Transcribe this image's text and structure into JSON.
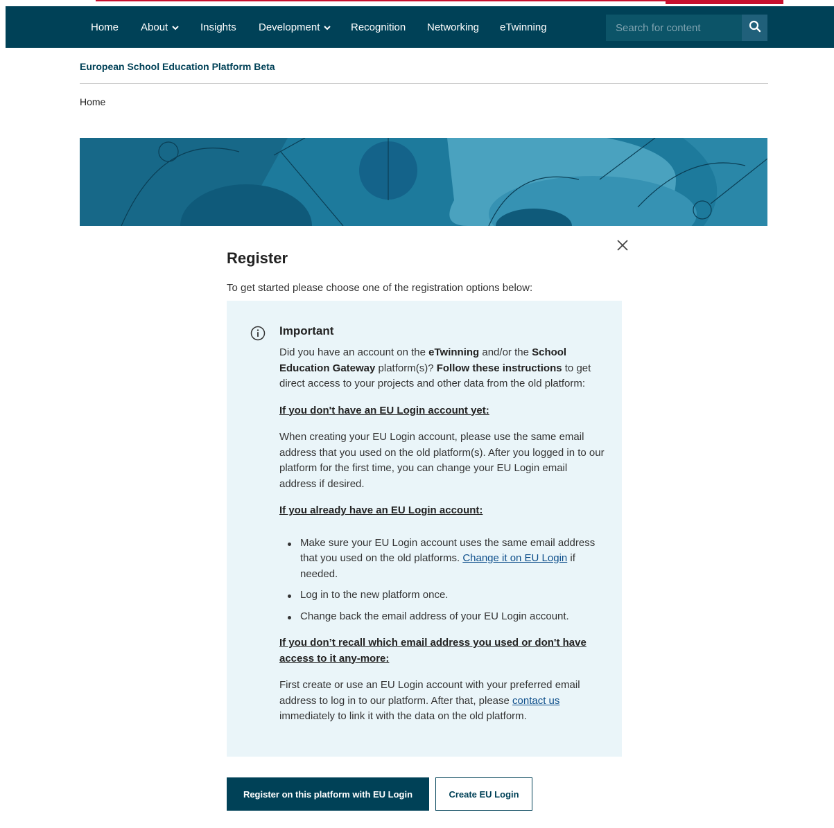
{
  "nav": {
    "items": [
      {
        "label": "Home",
        "has_dropdown": false
      },
      {
        "label": "About",
        "has_dropdown": true
      },
      {
        "label": "Insights",
        "has_dropdown": false
      },
      {
        "label": "Development",
        "has_dropdown": true
      },
      {
        "label": "Recognition",
        "has_dropdown": false
      },
      {
        "label": "Networking",
        "has_dropdown": false
      },
      {
        "label": "eTwinning",
        "has_dropdown": false
      }
    ],
    "search": {
      "placeholder": "Search for content",
      "icon": "search-icon"
    }
  },
  "site_title": "European School Education Platform Beta",
  "breadcrumb": "Home",
  "modal": {
    "close_icon": "close-icon",
    "title": "Register",
    "subtitle": "To get started please choose one of the registration options below:",
    "notice": {
      "icon": "info-icon",
      "heading": "Important",
      "intro": {
        "t1": "Did you have an account on the ",
        "b1": "eTwinning",
        "t2": " and/or the ",
        "b2": "School Education Gateway",
        "t3": " platform(s)? ",
        "b3": "Follow these instructions",
        "t4": " to get direct access to your projects and other data from the old platform:"
      },
      "section1_heading": "If you don't have an EU Login account yet:",
      "section1_text": "When creating your EU Login account, please use the same email address that you used on the old platform(s). After you logged in to our platform for the first time, you can change your EU Login email address if desired.",
      "section2_heading": "If you already have an EU Login account:",
      "bullets": {
        "b1_text": "Make sure your EU Login account uses the same email address that you used on the old platforms. ",
        "b1_link": "Change it on EU Login",
        "b1_after": " if needed.",
        "b2": "Log in to the new platform once.",
        "b3": "Change back the email address of your EU Login account."
      },
      "section3_heading": "If you don’t recall which email address you used or don't have access to it any-more:",
      "section3": {
        "t1": "First create or use an EU Login account with your preferred email address to log in to our platform. After that, please ",
        "link": "contact us",
        "t2": " immediately to link it with the data on the old platform."
      }
    },
    "buttons": {
      "primary": "Register on this platform with EU Login",
      "secondary": "Create EU Login"
    }
  },
  "colors": {
    "nav_bg": "#004157",
    "accent_red": "#c8102e",
    "notice_bg": "#eaf5f9",
    "banner_bg": "#1d7a9c"
  }
}
